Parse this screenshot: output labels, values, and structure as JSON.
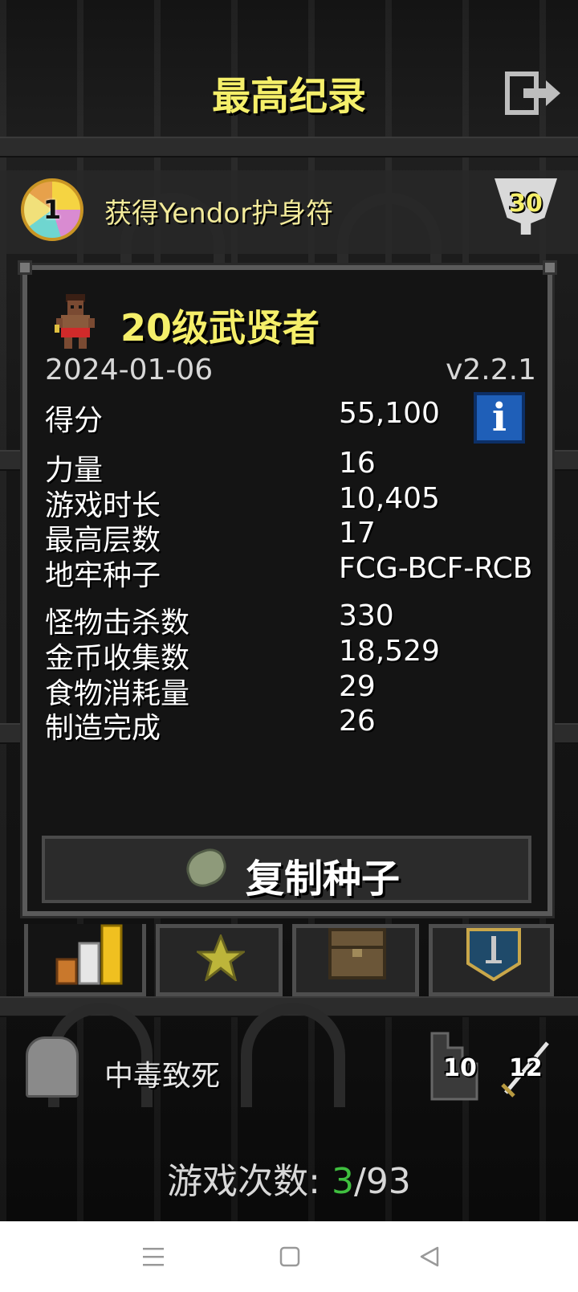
{
  "screen": {
    "title": "最高纪录",
    "exit_icon": "exit-door-icon"
  },
  "badge": {
    "medal_icon": "amulet-medal-icon",
    "medal_number": "1",
    "text": "获得Yendor护身符",
    "challenge_icon": "challenge-trophy-icon",
    "challenge_number": "30"
  },
  "record": {
    "hero_icon": "gladiator-hero-icon",
    "title": "20级武贤者",
    "date": "2024-01-06",
    "version": "v2.2.1",
    "info_icon": "info-icon",
    "info_label": "i",
    "stats": [
      {
        "label": "得分",
        "value": "55,100"
      },
      {
        "label": "力量",
        "value": "16"
      },
      {
        "label": "游戏时长",
        "value": "10,405"
      },
      {
        "label": "最高层数",
        "value": "17"
      },
      {
        "label": "地牢种子",
        "value": "FCG-BCF-RCB"
      },
      {
        "label": "怪物击杀数",
        "value": "330"
      },
      {
        "label": "金币收集数",
        "value": "18,529"
      },
      {
        "label": "食物消耗量",
        "value": "29"
      },
      {
        "label": "制造完成",
        "value": "26"
      }
    ],
    "copy_seed_label": "复制种子",
    "copy_seed_icon": "seed-icon"
  },
  "tabs": [
    {
      "icon": "stats-bars-icon",
      "active": true
    },
    {
      "icon": "badge-star-icon",
      "active": false
    },
    {
      "icon": "chest-icon",
      "active": false
    },
    {
      "icon": "sword-card-icon",
      "active": false
    }
  ],
  "death": {
    "icon": "tombstone-icon",
    "text": "中毒致死",
    "depth": "10",
    "depth_icon": "stairs-depth-icon",
    "level": "12",
    "level_icon": "sword-level-icon"
  },
  "games_played": {
    "label": "游戏次数: ",
    "current": "3",
    "separator": "/",
    "total": "93"
  },
  "nav": {
    "menu_icon": "menu-icon",
    "home_icon": "home-square-icon",
    "back_icon": "back-triangle-icon"
  },
  "colors": {
    "title_yellow": "#f5ef6a",
    "highlight_green": "#3fbf3f",
    "info_blue": "#1f5fb8"
  }
}
